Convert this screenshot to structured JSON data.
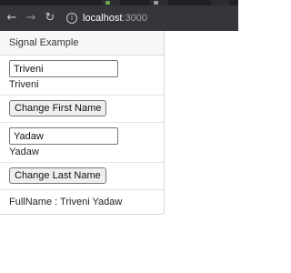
{
  "browser": {
    "url_host": "localhost",
    "url_port": ":3000"
  },
  "app": {
    "header_title": "Signal Example",
    "first_name_input_value": "Triveni",
    "first_name_display": "Triveni",
    "change_first_button_label": "Change First Name",
    "last_name_input_value": "Yadaw",
    "last_name_display": "Yadaw",
    "change_last_button_label": "Change Last Name",
    "fullname_text": "FullName : Triveni Yadaw"
  }
}
